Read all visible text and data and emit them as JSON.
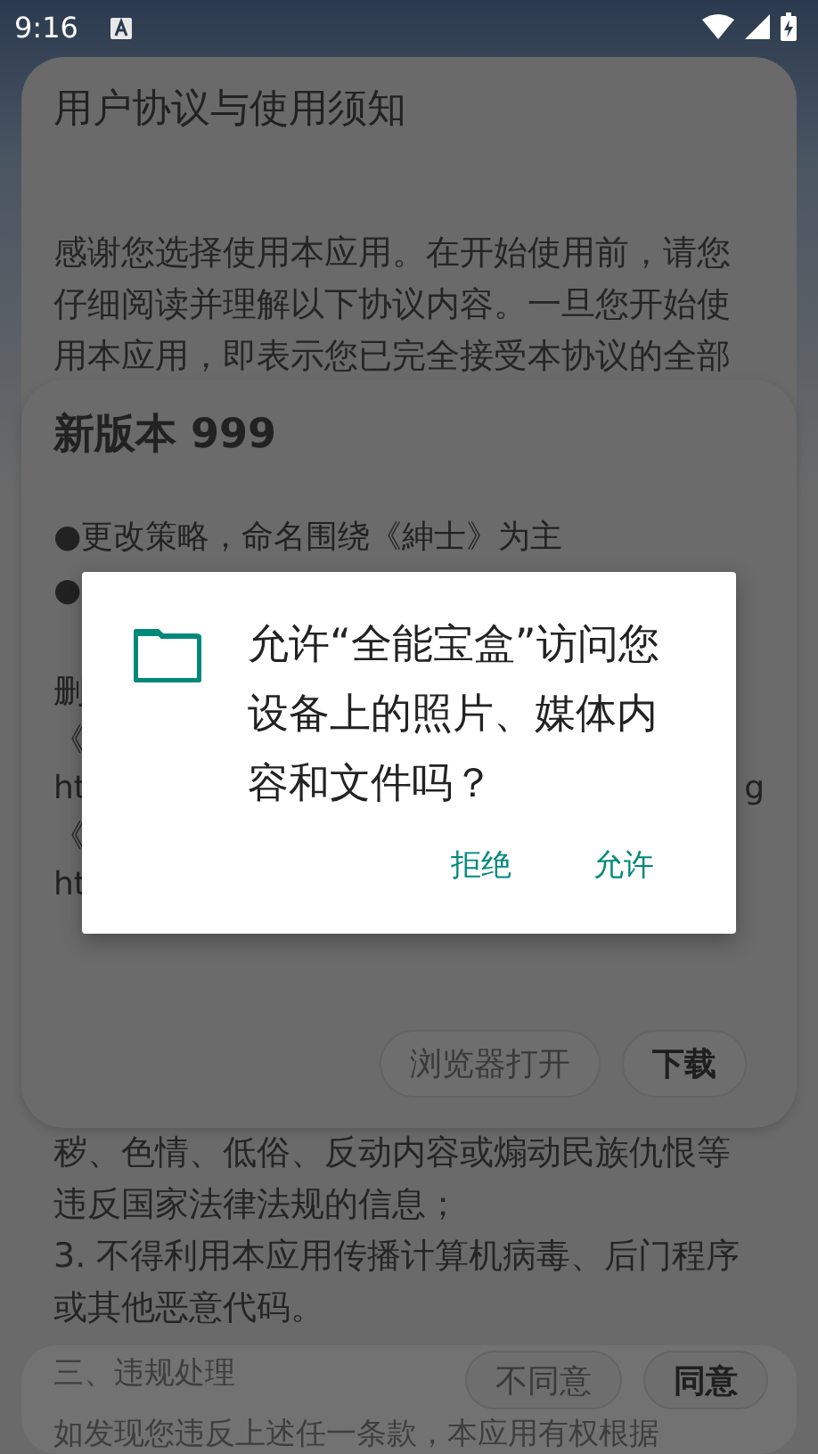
{
  "status_bar": {
    "time": "9:16"
  },
  "agreement_dialog": {
    "title": "用户协议与使用须知",
    "intro_lines": [
      "感谢您选择使用本应用。在开始使用前，请您",
      "仔细阅读并理解以下协议内容。一旦您开始使",
      "用本应用，即表示您已完全接受本协议的全部"
    ],
    "body_lines": [
      "秽、色情、低俗、反动内容或煽动民族仇恨等",
      "违反国家法律法规的信息；",
      "3. 不得利用本应用传播计算机病毒、后门程序",
      "或其他恶意代码。"
    ],
    "section_heading": "三、违规处理",
    "section_text": "如发现您违反上述任一条款，本应用有权根据",
    "buttons": [
      {
        "label": "不同意",
        "kind": "secondary"
      },
      {
        "label": "同意",
        "kind": "primary"
      }
    ]
  },
  "update_dialog": {
    "title": "新版本 999",
    "bullets": [
      "●更改策略，命名围绕《紳士》为主",
      "●"
    ],
    "fragments": [
      {
        "left": "删"
      },
      {
        "left": "《"
      },
      {
        "left": "ht",
        "right": "g"
      },
      {
        "left": "《"
      },
      {
        "left": "ht"
      }
    ],
    "buttons": [
      {
        "label": "浏览器打开",
        "kind": "secondary"
      },
      {
        "label": "下载",
        "kind": "primary"
      }
    ]
  },
  "permission_dialog": {
    "message": "允许“全能宝盒”访问您设备上的照片、媒体内容和文件吗？",
    "buttons": [
      {
        "label": "拒绝"
      },
      {
        "label": "允许"
      }
    ]
  }
}
